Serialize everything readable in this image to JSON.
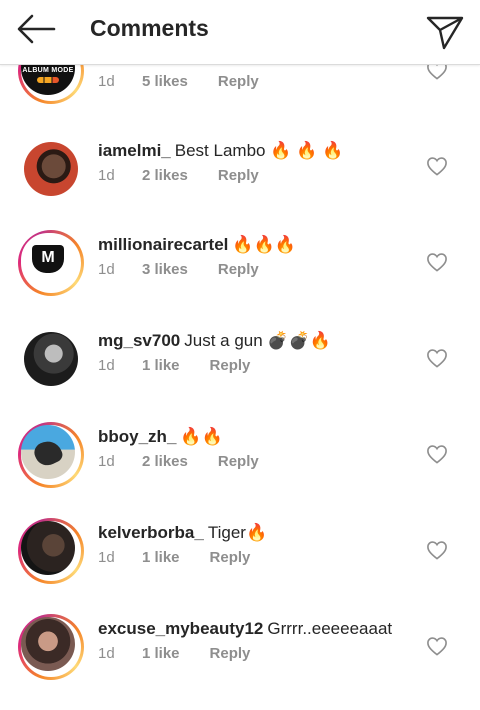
{
  "header": {
    "title": "Comments",
    "back_icon": "arrow-left-icon",
    "send_icon": "paper-plane-icon"
  },
  "colors": {
    "text": "#262626",
    "meta": "#8e8e8e",
    "divider": "#dbdbdb",
    "ring_start": "#f58529",
    "ring_end": "#dd2a7b"
  },
  "comments": [
    {
      "username": "",
      "text": "",
      "time": "1d",
      "likes": "5 likes",
      "reply": "Reply",
      "avatar_text": "ALBUM MODE"
    },
    {
      "username": "iamelmi_",
      "text": "Best Lambo 🔥 🔥 🔥",
      "time": "1d",
      "likes": "2 likes",
      "reply": "Reply"
    },
    {
      "username": "millionairecartel",
      "text": "🔥🔥🔥",
      "time": "1d",
      "likes": "3 likes",
      "reply": "Reply",
      "avatar_text": "M"
    },
    {
      "username": "mg_sv700",
      "text": "Just a gun 💣💣🔥",
      "time": "1d",
      "likes": "1 like",
      "reply": "Reply"
    },
    {
      "username": "bboy_zh_",
      "text": "🔥🔥",
      "time": "1d",
      "likes": "2 likes",
      "reply": "Reply"
    },
    {
      "username": "kelverborba_",
      "text": "Tiger🔥",
      "time": "1d",
      "likes": "1 like",
      "reply": "Reply"
    },
    {
      "username": "excuse_mybeauty12",
      "text": "Grrrr..eeeeeaaat",
      "time": "1d",
      "likes": "1 like",
      "reply": "Reply"
    }
  ]
}
